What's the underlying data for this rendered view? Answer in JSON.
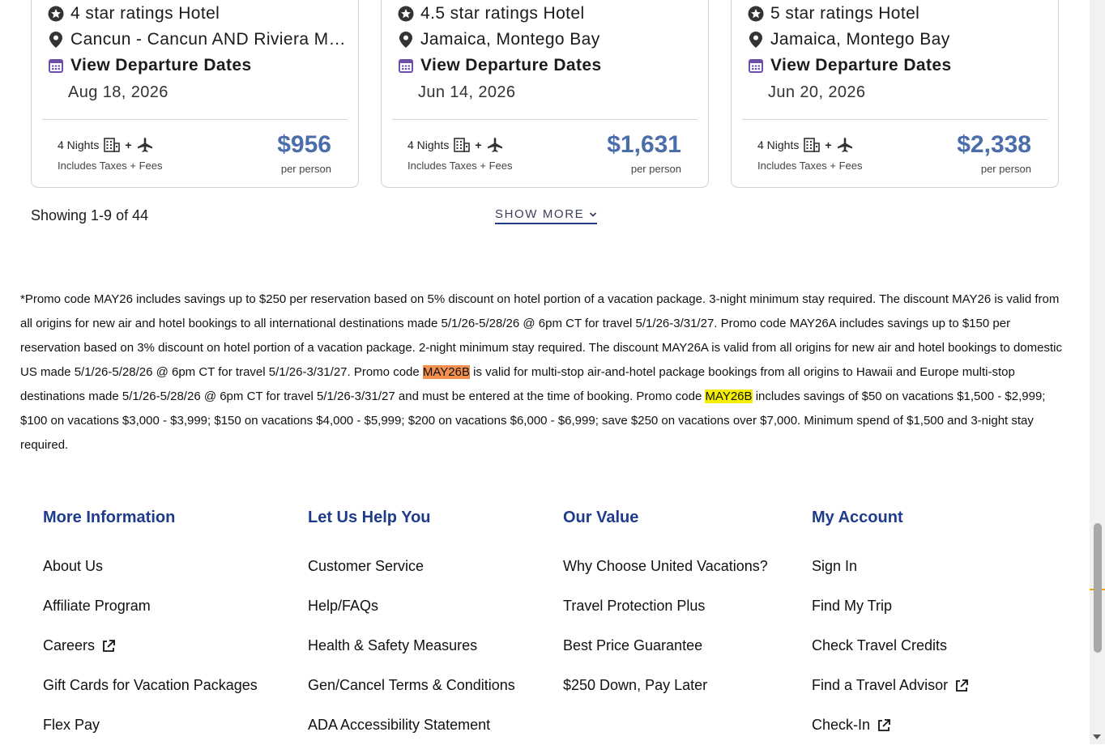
{
  "cards": [
    {
      "rating": "4 star ratings Hotel",
      "location": "Cancun - Cancun AND Riviera Maya",
      "departure_label": "View Departure Dates",
      "date": "Aug 18, 2026",
      "nights": "4 Nights",
      "fees": "Includes Taxes + Fees",
      "price": "$956",
      "per_person": "per person"
    },
    {
      "rating": "4.5 star ratings Hotel",
      "location": "Jamaica, Montego Bay",
      "departure_label": "View Departure Dates",
      "date": "Jun 14, 2026",
      "nights": "4 Nights",
      "fees": "Includes Taxes + Fees",
      "price": "$1,631",
      "per_person": "per person"
    },
    {
      "rating": "5 star ratings Hotel",
      "location": "Jamaica, Montego Bay",
      "departure_label": "View Departure Dates",
      "date": "Jun 20, 2026",
      "nights": "4 Nights",
      "fees": "Includes Taxes + Fees",
      "price": "$2,338",
      "per_person": "per person"
    }
  ],
  "pagination": {
    "showing": "Showing 1-9 of 44",
    "show_more": "SHOW MORE"
  },
  "disclaimer": {
    "part1": "*Promo code MAY26 includes savings up to $250 per reservation based on 5% discount on hotel portion of a vacation package. 3-night minimum stay required. The discount MAY26 is valid from all origins for new air and hotel bookings to all international destinations made 5/1/26-5/28/26 @ 6pm CT for travel 5/1/26-3/31/27. Promo code MAY26A includes savings up to $150 per reservation based on 3% discount on hotel portion of a vacation package. 2-night minimum stay required. The discount MAY26A is valid from all origins for new air and hotel bookings to domestic US made 5/1/26-5/28/26 @ 6pm CT for travel 5/1/26-3/31/27. Promo code ",
    "code1": "MAY26B",
    "part2": " is valid for multi-stop air-and-hotel package bookings from all origins to Hawaii and Europe multi-stop destinations made 5/1/26-5/28/26 @ 6pm CT for travel 5/1/26-3/31/27 and must be entered at the time of booking. Promo code ",
    "code2": "MAY26B",
    "part3": " includes savings of $50 on vacations $1,500 - $2,999; $100 on vacations $3,000 - $3,999; $150 on vacations $4,000 - $5,999; $200 on vacations $6,000 - $6,999; save $250 on vacations over $7,000. Minimum spend of $1,500 and 3-night stay required."
  },
  "footer": {
    "columns": [
      {
        "heading": "More Information",
        "links": [
          "About Us",
          "Affiliate Program",
          "Careers",
          "Gift Cards for Vacation Packages",
          "Flex Pay"
        ]
      },
      {
        "heading": "Let Us Help You",
        "links": [
          "Customer Service",
          "Help/FAQs",
          "Health & Safety Measures",
          "Gen/Cancel Terms & Conditions",
          "ADA Accessibility Statement"
        ]
      },
      {
        "heading": "Our Value",
        "links": [
          "Why Choose United Vacations?",
          "Travel Protection Plus",
          "Best Price Guarantee",
          "$250 Down, Pay Later"
        ]
      },
      {
        "heading": "My Account",
        "links": [
          "Sign In",
          "Find My Trip",
          "Check Travel Credits",
          "Find a Travel Advisor",
          "Check-In"
        ]
      }
    ]
  },
  "colors": {
    "price": "#4a6dab",
    "footer_heading": "#1f3b8c",
    "calendar_icon": "#6b4fa8",
    "highlight_orange": "#f3904f",
    "highlight_yellow": "#f6f000"
  },
  "icons": [
    "star-icon",
    "location-pin-icon",
    "calendar-icon",
    "hotel-icon",
    "plane-icon",
    "chevron-down-icon",
    "external-link-icon"
  ]
}
